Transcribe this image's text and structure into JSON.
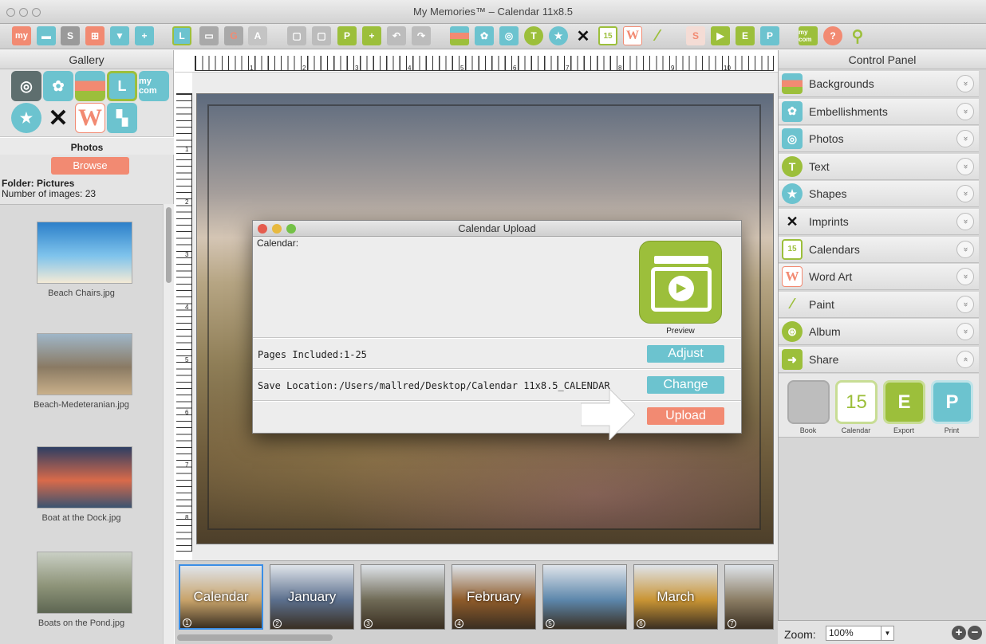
{
  "window": {
    "title": "My Memories™ – Calendar 11x8.5"
  },
  "toolbar": {
    "my_logo": "my",
    "mycom_label": "my com"
  },
  "gallery": {
    "title": "Gallery",
    "section_title": "Photos",
    "browse_label": "Browse",
    "folder_text": "Folder: Pictures",
    "count_text": "Number of images: 23",
    "icons": [
      "photos-icon",
      "embellishments-icon",
      "backgrounds-icon",
      "layouts-icon",
      "mycom-icon",
      "shapes-icon",
      "imprints-icon",
      "wordart-icon",
      "templates-icon"
    ],
    "thumbs": [
      {
        "label": "Beach Chairs.jpg",
        "colors": [
          "#2c7fc9",
          "#7ec3ec",
          "#f4ead6"
        ]
      },
      {
        "label": "Beach-Medeteranian.jpg",
        "colors": [
          "#9fb6c8",
          "#8a7a63",
          "#c9b08a"
        ]
      },
      {
        "label": "Boat at the Dock.jpg",
        "colors": [
          "#2d3e63",
          "#d96a4a",
          "#3a5370"
        ]
      },
      {
        "label": "Boats on the Pond.jpg",
        "colors": [
          "#c9cfc4",
          "#8e9479",
          "#5d6652"
        ]
      }
    ]
  },
  "ruler": {
    "h_numbers": [
      "1",
      "2",
      "3",
      "4",
      "5",
      "6",
      "7",
      "8",
      "9",
      "10"
    ],
    "v_numbers": [
      "1",
      "2",
      "3",
      "4",
      "5",
      "6",
      "7",
      "8"
    ]
  },
  "filmstrip": [
    {
      "label": "Calendar",
      "num": "1",
      "bg": "#c8a36a"
    },
    {
      "label": "January",
      "num": "2",
      "bg": "#5b6f8d"
    },
    {
      "label": "",
      "num": "3",
      "bg": "#6f6a56"
    },
    {
      "label": "February",
      "num": "4",
      "bg": "#8e5b2a"
    },
    {
      "label": "",
      "num": "5",
      "bg": "#5c86ab"
    },
    {
      "label": "March",
      "num": "6",
      "bg": "#c99434"
    },
    {
      "label": "",
      "num": "7",
      "bg": "#8a7c63"
    }
  ],
  "control_panel": {
    "title": "Control Panel",
    "items": [
      {
        "label": "Backgrounds",
        "icon": "backgrounds-icon",
        "chev": "»"
      },
      {
        "label": "Embellishments",
        "icon": "embellishments-icon",
        "chev": "»"
      },
      {
        "label": "Photos",
        "icon": "photos-icon",
        "chev": "»"
      },
      {
        "label": "Text",
        "icon": "text-icon",
        "chev": "»"
      },
      {
        "label": "Shapes",
        "icon": "shapes-icon",
        "chev": "»"
      },
      {
        "label": "Imprints",
        "icon": "imprints-icon",
        "chev": "»"
      },
      {
        "label": "Calendars",
        "icon": "calendars-icon",
        "chev": "»"
      },
      {
        "label": "Word Art",
        "icon": "wordart-icon",
        "chev": "»"
      },
      {
        "label": "Paint",
        "icon": "paint-icon",
        "chev": "»"
      },
      {
        "label": "Album",
        "icon": "album-icon",
        "chev": "»"
      },
      {
        "label": "Share",
        "icon": "share-icon",
        "chev": "«"
      }
    ],
    "share": [
      {
        "label": "Book",
        "glyph": "",
        "num": ""
      },
      {
        "label": "Calendar",
        "glyph": "15",
        "num": "15"
      },
      {
        "label": "Export",
        "glyph": "E",
        "num": ""
      },
      {
        "label": "Print",
        "glyph": "P",
        "num": ""
      }
    ],
    "zoom_label": "Zoom:",
    "zoom_value": "100%",
    "zoom_in": "+",
    "zoom_out": "−"
  },
  "dialog": {
    "title": "Calendar Upload",
    "calendar_label": "Calendar:",
    "preview_label": "Preview",
    "pages_label": "Pages Included:",
    "pages_value": "1-25",
    "save_label": "Save Location:",
    "save_value": "/Users/mallred/Desktop/Calendar 11x8.5_CALENDAR",
    "adjust_label": "Adjust",
    "change_label": "Change",
    "upload_label": "Upload"
  },
  "colors": {
    "accent_coral": "#f28a72",
    "accent_teal": "#6cc3cf",
    "accent_lime": "#9cbf3b"
  }
}
